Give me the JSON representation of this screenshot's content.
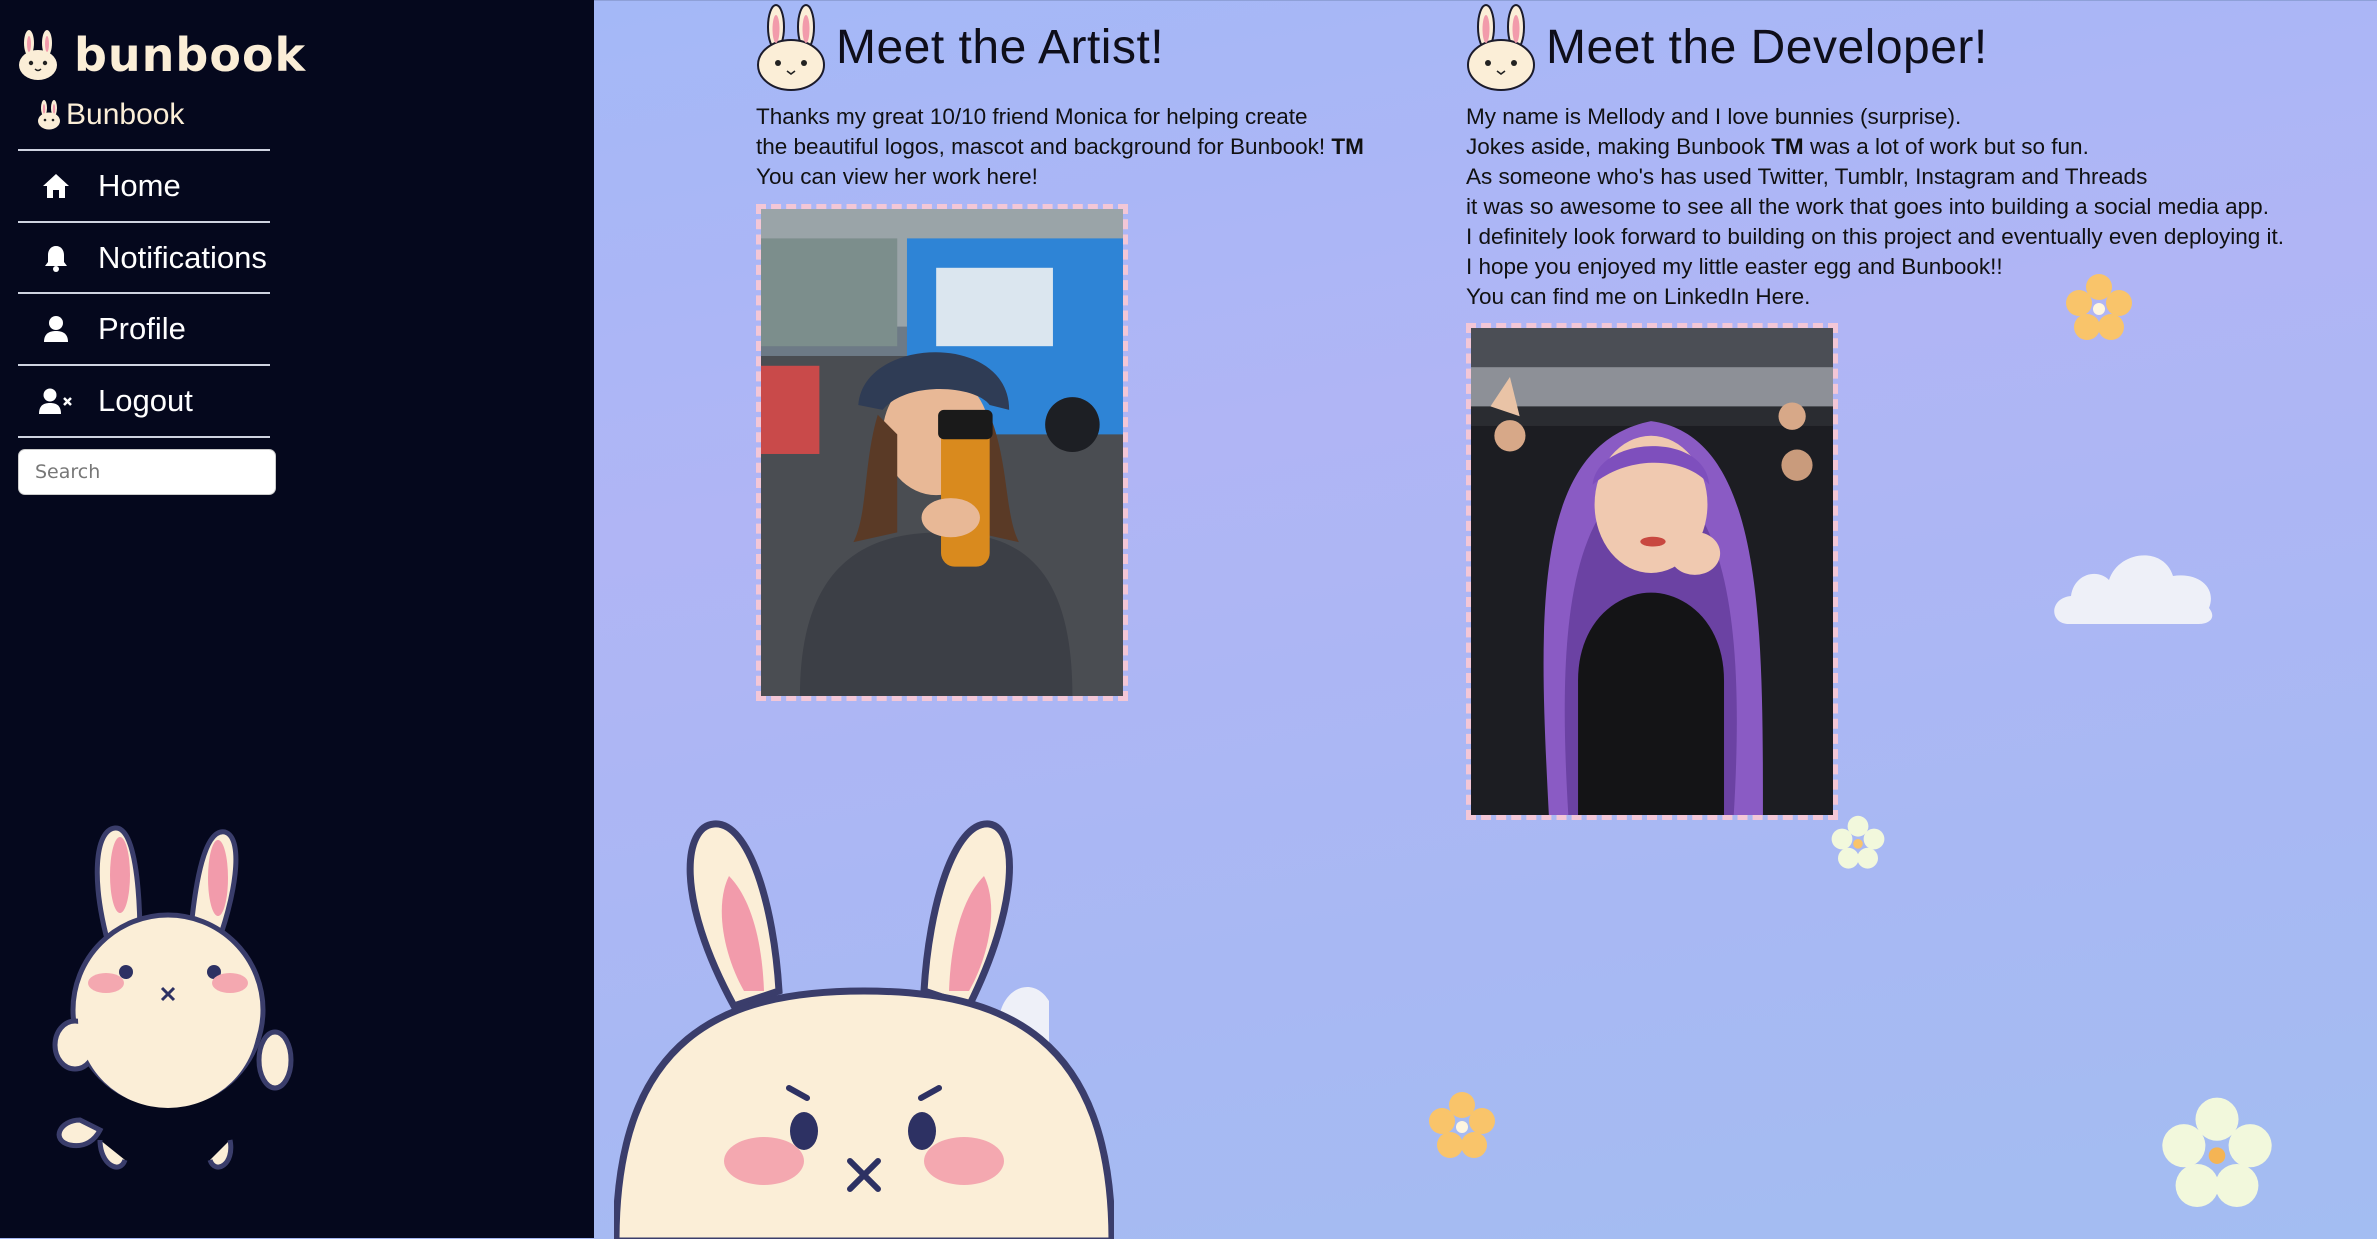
{
  "sidebar": {
    "brand": "bunbook",
    "brand_sub": "Bunbook",
    "nav": [
      {
        "label": "Home",
        "icon": "home-icon"
      },
      {
        "label": "Notifications",
        "icon": "bell-icon"
      },
      {
        "label": "Profile",
        "icon": "user-icon"
      },
      {
        "label": "Logout",
        "icon": "user-remove-icon"
      }
    ],
    "search_placeholder": "Search"
  },
  "artist": {
    "title": "Meet the Artist!",
    "lines": [
      "Thanks my great 10/10 friend Monica for helping create",
      "the beautiful logos, mascot and background for Bunbook! ",
      "You can view her work "
    ],
    "tm": "TM",
    "link": "here",
    "link_suffix": "!"
  },
  "developer": {
    "title": "Meet the Developer!",
    "lines": [
      "My name is Mellody and I love bunnies (surprise).",
      "Jokes aside, making Bunbook ",
      " was a lot of work but so fun.",
      "As someone who's has used Twitter, Tumblr, Instagram and Threads",
      "it was so awesome to see all the work that goes into building a social media app.",
      "I definitely look forward to building on this project and eventually even deploying it.",
      "I hope you enjoyed my little easter egg and Bunbook!!",
      "You can find me on LinkedIn "
    ],
    "tm": "TM",
    "link": "Here",
    "link_suffix": "."
  },
  "colors": {
    "sidebar_bg": "#05081d",
    "main_bg": "#a6b8f5",
    "frame_border": "#f3c7d7",
    "bunny_cream": "#fbeed7",
    "bunny_outline": "#3a3d6b",
    "bunny_ear_pink": "#f29bab"
  }
}
